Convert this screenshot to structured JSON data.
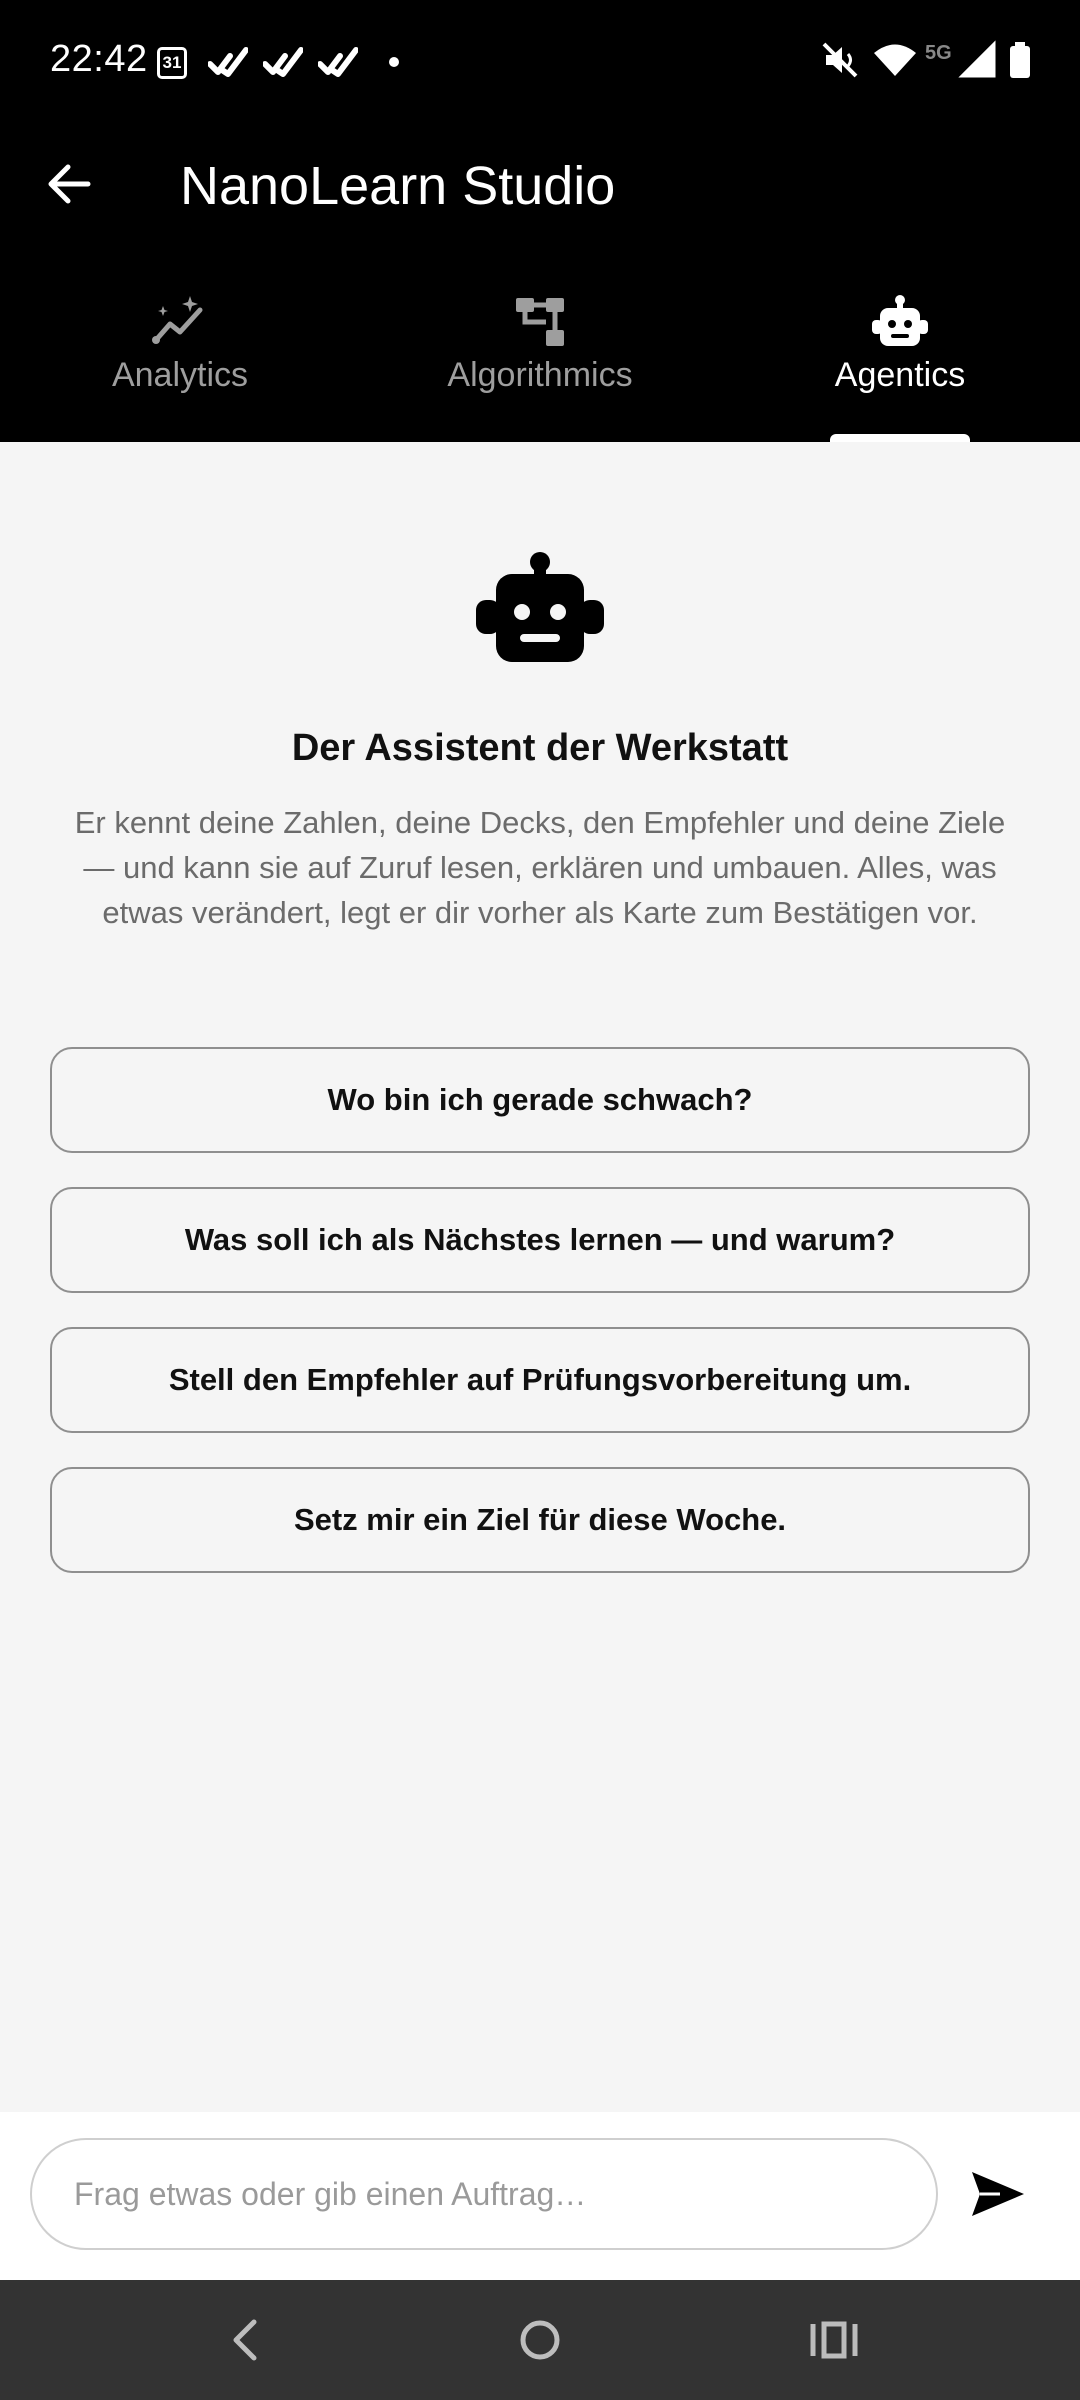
{
  "status_bar": {
    "time": "22:42",
    "calendar_day": "31",
    "network": "5G",
    "icons": [
      "calendar-icon",
      "check-icon",
      "check-icon",
      "check-icon",
      "dot-icon",
      "mute-icon",
      "wifi-icon",
      "signal-icon",
      "battery-icon"
    ]
  },
  "app_bar": {
    "title": "NanoLearn Studio",
    "back_icon": "arrow-left-icon"
  },
  "tabs": [
    {
      "label": "Analytics",
      "icon": "sparkle-chart-icon",
      "active": false
    },
    {
      "label": "Algorithmics",
      "icon": "flow-chart-icon",
      "active": false
    },
    {
      "label": "Agentics",
      "icon": "robot-icon",
      "active": true
    }
  ],
  "hero": {
    "icon": "robot-icon",
    "title": "Der Assistent der Werkstatt",
    "description": "Er kennt deine Zahlen, deine Decks, den Empfehler und deine Ziele — und kann sie auf Zuruf lesen, erklären und umbauen. Alles, was etwas verändert, legt er dir vorher als Karte zum Bestätigen vor."
  },
  "suggestions": [
    "Wo bin ich gerade schwach?",
    "Was soll ich als Nächstes lernen — und warum?",
    "Stell den Empfehler auf Prüfungsvorbereitung um.",
    "Setz mir ein Ziel für diese Woche."
  ],
  "composer": {
    "value": "",
    "placeholder": "Frag etwas oder gib einen Auftrag…",
    "send_icon": "send-icon"
  },
  "colors": {
    "app_bar_bg": "#000000",
    "content_bg": "#f5f5f5",
    "tab_inactive": "#9e9e9e",
    "tab_active": "#ffffff",
    "nav_bar_bg": "#333333"
  }
}
